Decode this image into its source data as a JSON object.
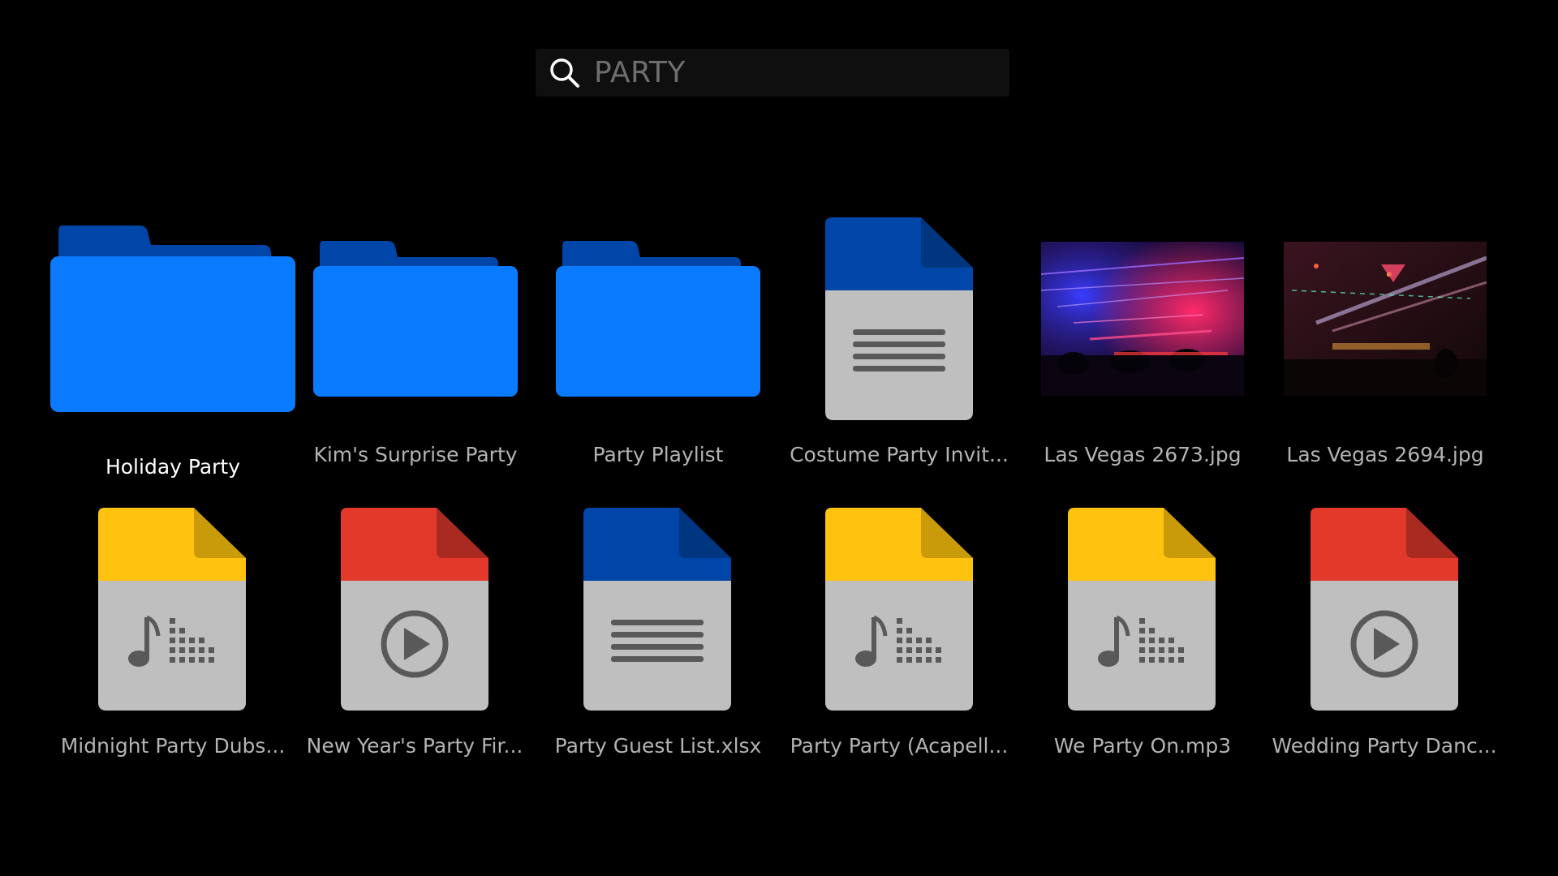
{
  "search": {
    "value": "PARTY",
    "icon": "search-icon"
  },
  "colors": {
    "background": "#000000",
    "folder_front": "#0a7bff",
    "folder_back": "#0046a8",
    "doc_blue": "#0046a8",
    "doc_yellow": "#ffc20e",
    "doc_red": "#e3392b",
    "doc_body": "#bfbfbf",
    "doc_glyph": "#595959",
    "label_dim": "#b3b3b3",
    "label_focused": "#ffffff"
  },
  "results": [
    {
      "name": "Holiday Party",
      "kind": "folder",
      "focused": true
    },
    {
      "name": "Kim's Surprise Party",
      "kind": "folder",
      "focused": false
    },
    {
      "name": "Party Playlist",
      "kind": "folder",
      "focused": false
    },
    {
      "name": "Costume Party Invit...",
      "kind": "document",
      "icon": "document-icon",
      "focused": false
    },
    {
      "name": "Las Vegas 2673.jpg",
      "kind": "photo",
      "icon": "photo-thumbnail",
      "focused": false
    },
    {
      "name": "Las Vegas 2694.jpg",
      "kind": "photo",
      "icon": "photo-thumbnail",
      "focused": false
    },
    {
      "name": "Midnight Party Dubs...",
      "kind": "audio",
      "icon": "audio-file-icon",
      "focused": false
    },
    {
      "name": "New Year's Party Fir...",
      "kind": "video",
      "icon": "video-file-icon",
      "focused": false
    },
    {
      "name": "Party Guest List.xlsx",
      "kind": "document",
      "icon": "document-icon",
      "focused": false
    },
    {
      "name": "Party Party (Acapell...",
      "kind": "audio",
      "icon": "audio-file-icon",
      "focused": false
    },
    {
      "name": "We Party On.mp3",
      "kind": "audio",
      "icon": "audio-file-icon",
      "focused": false
    },
    {
      "name": "Wedding Party Danc...",
      "kind": "video",
      "icon": "video-file-icon",
      "focused": false
    }
  ]
}
